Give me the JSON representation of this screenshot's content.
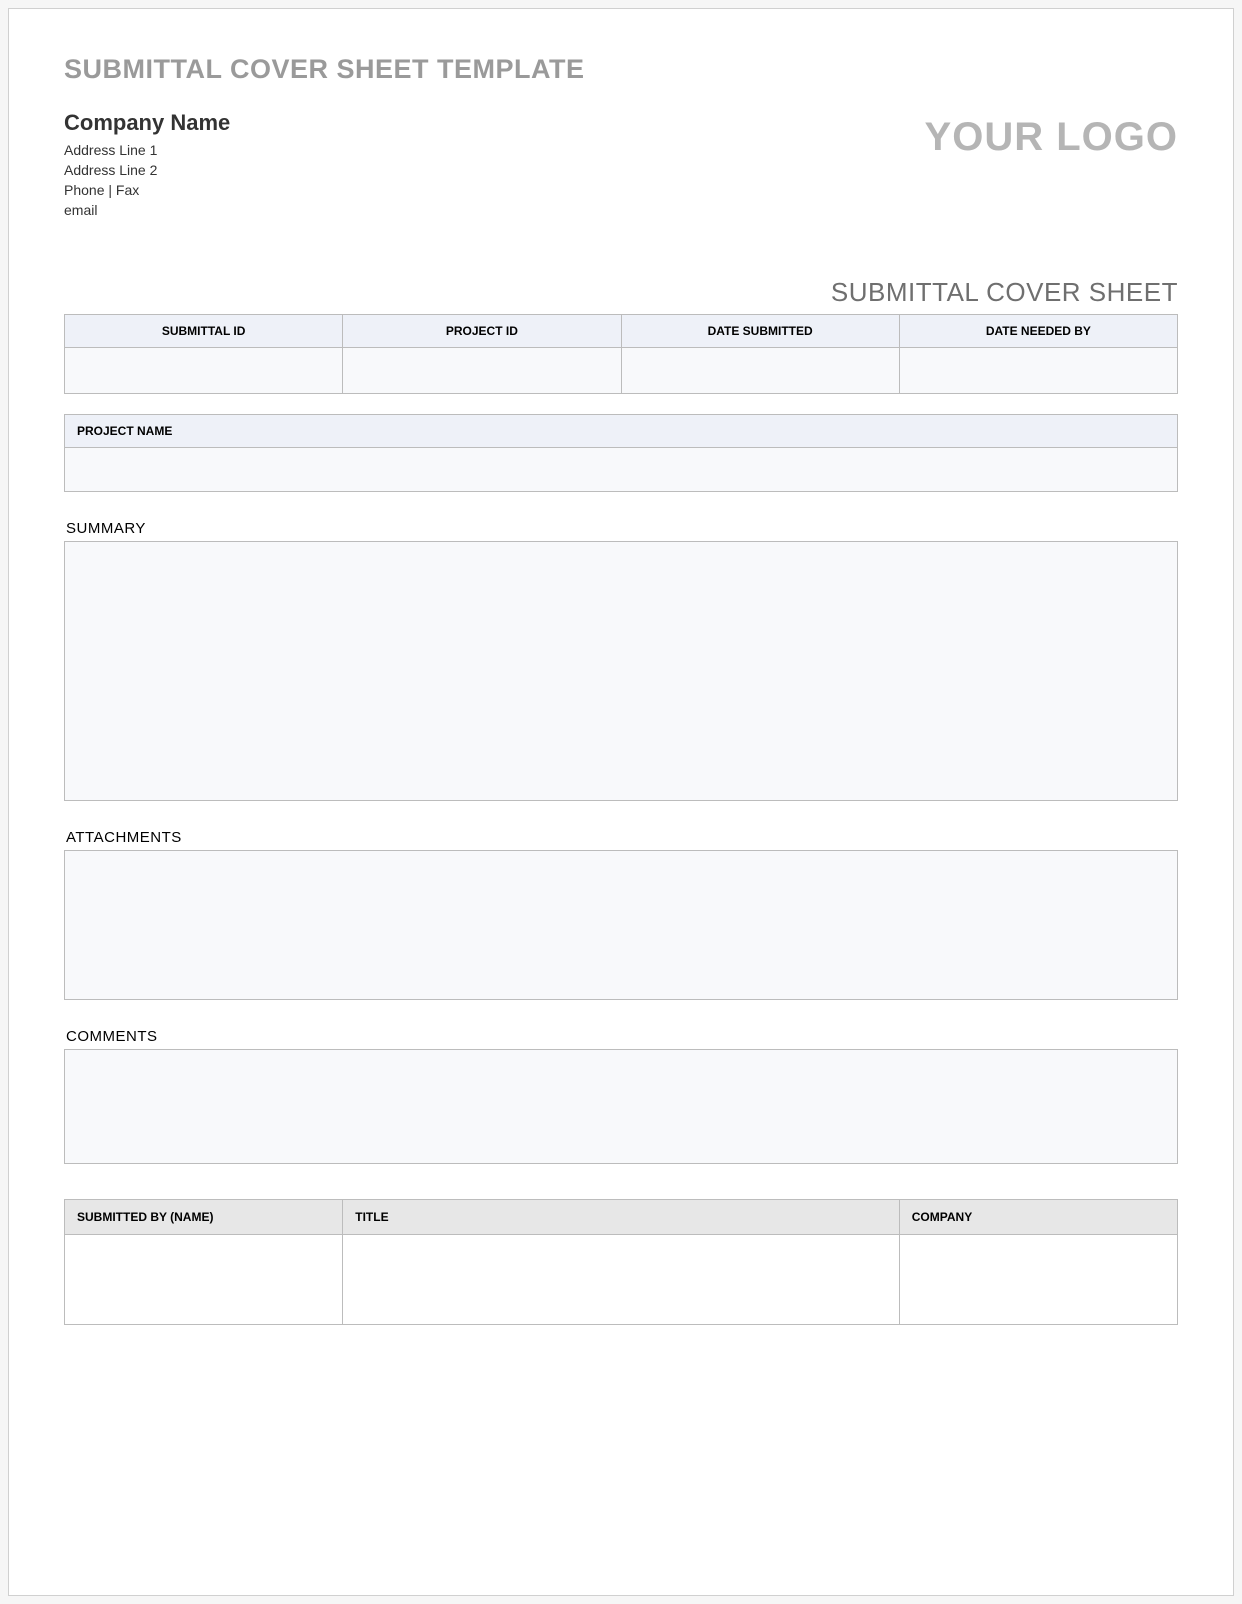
{
  "template_title": "SUBMITTAL COVER SHEET TEMPLATE",
  "company": {
    "name": "Company Name",
    "address_line_1": "Address Line 1",
    "address_line_2": "Address Line 2",
    "phone_fax": "Phone  |  Fax",
    "email": "email"
  },
  "logo_placeholder": "YOUR LOGO",
  "doc_title": "SUBMITTAL COVER SHEET",
  "info_headers": {
    "submittal_id": "SUBMITTAL ID",
    "project_id": "PROJECT ID",
    "date_submitted": "DATE SUBMITTED",
    "date_needed_by": "DATE NEEDED BY"
  },
  "info_values": {
    "submittal_id": "",
    "project_id": "",
    "date_submitted": "",
    "date_needed_by": ""
  },
  "project_name_header": "PROJECT NAME",
  "project_name_value": "",
  "sections": {
    "summary_label": "SUMMARY",
    "summary_value": "",
    "attachments_label": "ATTACHMENTS",
    "attachments_value": "",
    "comments_label": "COMMENTS",
    "comments_value": ""
  },
  "footer_headers": {
    "submitted_by": "SUBMITTED BY (NAME)",
    "title": "TITLE",
    "company": "COMPANY"
  },
  "footer_values": {
    "submitted_by": "",
    "title": "",
    "company": ""
  }
}
